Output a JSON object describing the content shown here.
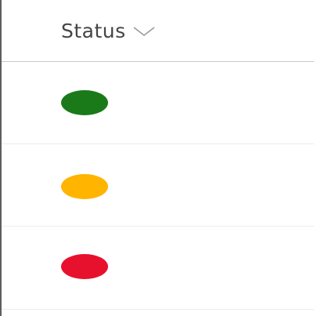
{
  "column": {
    "header_label": "Status",
    "sort_icon": "chevron-down-icon"
  },
  "rows": [
    {
      "status_color": "#1a7a1a",
      "status": "green"
    },
    {
      "status_color": "#ffb400",
      "status": "yellow"
    },
    {
      "status_color": "#e8112d",
      "status": "red"
    }
  ],
  "colors": {
    "border": "#5e5e5e",
    "header_divider": "#c9c9c9",
    "row_divider": "#ececec",
    "header_text": "#454545"
  }
}
